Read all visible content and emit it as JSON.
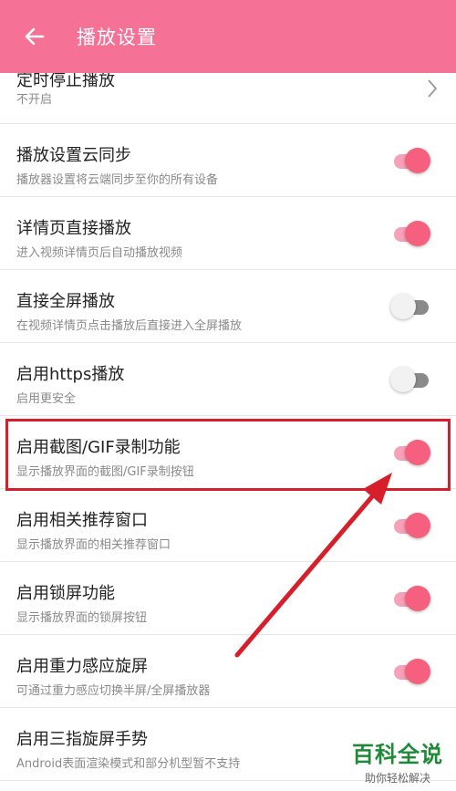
{
  "header": {
    "title": "播放设置",
    "back_icon": "arrow-left-icon"
  },
  "colors": {
    "accent": "#f57196",
    "toggle_on": "#f5607f",
    "highlight": "#d61f2a"
  },
  "settings": [
    {
      "title": "定时停止播放",
      "subtitle": "不开启",
      "control": "chevron"
    },
    {
      "title": "播放设置云同步",
      "subtitle": "播放器设置将云端同步至你的所有设备",
      "control": "toggle",
      "on": true
    },
    {
      "title": "详情页直接播放",
      "subtitle": "进入视频详情页后自动播放视频",
      "control": "toggle",
      "on": true
    },
    {
      "title": "直接全屏播放",
      "subtitle": "在视频详情页点击播放后直接进入全屏播放",
      "control": "toggle",
      "on": false
    },
    {
      "title": "启用https播放",
      "subtitle": "启用更安全",
      "control": "toggle",
      "on": false
    },
    {
      "title": "启用截图/GIF录制功能",
      "subtitle": "显示播放界面的截图/GIF录制按钮",
      "control": "toggle",
      "on": true
    },
    {
      "title": "启用相关推荐窗口",
      "subtitle": "显示播放界面的相关推荐窗口",
      "control": "toggle",
      "on": true
    },
    {
      "title": "启用锁屏功能",
      "subtitle": "显示播放界面的锁屏按钮",
      "control": "toggle",
      "on": true
    },
    {
      "title": "启用重力感应旋屏",
      "subtitle": "可通过重力感应切换半屏/全屏播放器",
      "control": "toggle",
      "on": true
    },
    {
      "title": "启用三指旋屏手势",
      "subtitle": "Android表面渲染模式和部分机型暂不支持",
      "control": "none"
    }
  ],
  "watermark": {
    "title": "百科全说",
    "subtitle": "助你轻松解决"
  }
}
